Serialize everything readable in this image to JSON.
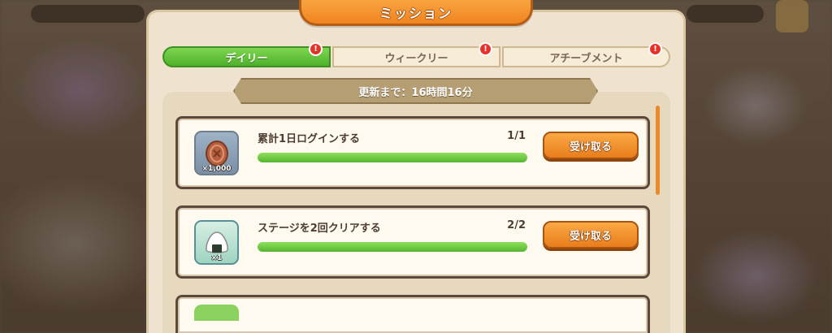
{
  "window": {
    "title": "ミッション"
  },
  "tabs": [
    {
      "label": "デイリー",
      "active": true,
      "badge": "!"
    },
    {
      "label": "ウィークリー",
      "active": false,
      "badge": "!"
    },
    {
      "label": "アチーブメント",
      "active": false,
      "badge": "!"
    }
  ],
  "timer": {
    "text": "更新まで：16時間16分"
  },
  "missions": [
    {
      "icon": "coin-icon",
      "reward_qty": "×1,000",
      "text": "累計1日ログインする",
      "progress_text": "1/1",
      "progress": 1.0,
      "button_label": "受け取る"
    },
    {
      "icon": "rice-ball-icon",
      "reward_qty": "×1",
      "text": "ステージを2回クリアする",
      "progress_text": "2/2",
      "progress": 1.0,
      "button_label": "受け取る"
    }
  ],
  "colors": {
    "accent_orange": "#ef8420",
    "tab_active_green": "#4fb02c",
    "badge_red": "#e8312a",
    "panel_cream": "#efe3cf"
  }
}
